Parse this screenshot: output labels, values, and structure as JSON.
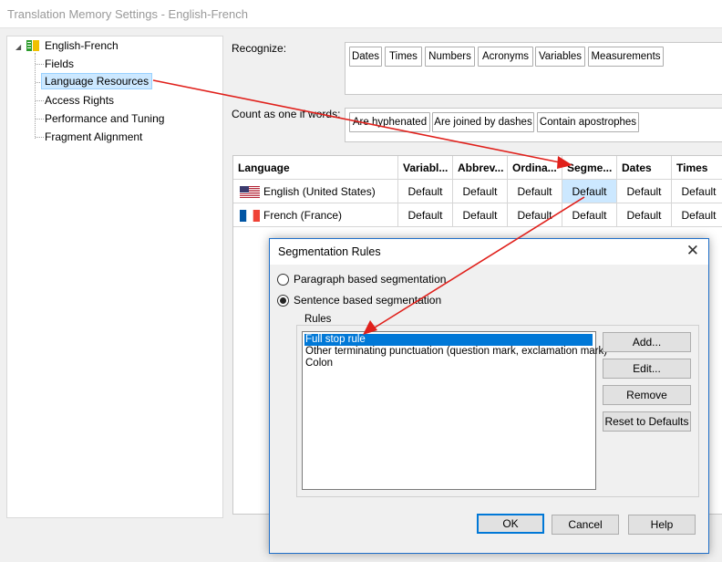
{
  "window": {
    "title": "Translation Memory Settings - English-French"
  },
  "tree": {
    "root": "English-French",
    "items": [
      "Fields",
      "Language Resources",
      "Access Rights",
      "Performance and Tuning",
      "Fragment Alignment"
    ],
    "selected": "Language Resources"
  },
  "recognize": {
    "label": "Recognize:",
    "tokens": [
      "Dates",
      "Times",
      "Numbers",
      "Acronyms",
      "Variables",
      "Measurements"
    ]
  },
  "count_as_one": {
    "label": "Count as one if words:",
    "tokens": [
      "Are hyphenated",
      "Are joined by dashes",
      "Contain apostrophes"
    ]
  },
  "grid": {
    "headers": [
      "Language",
      "Variabl...",
      "Abbrev...",
      "Ordina...",
      "Segme...",
      "Dates",
      "Times"
    ],
    "rows": [
      {
        "language": "English (United States)",
        "flag": "us-flag",
        "values": [
          "Default",
          "Default",
          "Default",
          "Default",
          "Default",
          "Default"
        ]
      },
      {
        "language": "French (France)",
        "flag": "fr-flag",
        "values": [
          "Default",
          "Default",
          "Default",
          "Default",
          "Default",
          "Default"
        ]
      }
    ],
    "selected_column": "Segme..."
  },
  "dialog": {
    "title": "Segmentation Rules",
    "options": [
      "Paragraph based segmentation",
      "Sentence based segmentation"
    ],
    "selected_option": "Sentence based segmentation",
    "rules_label": "Rules",
    "rules": [
      "Full stop rule",
      "Other terminating punctuation (question mark, exclamation mark)",
      "Colon"
    ],
    "selected_rule": "Full stop rule",
    "side_buttons": [
      "Add...",
      "Edit...",
      "Remove",
      "Reset to Defaults"
    ],
    "footer_buttons": [
      "OK",
      "Cancel",
      "Help"
    ]
  },
  "colors": {
    "accent": "#0078d7",
    "annotation_arrow": "#e0201b",
    "selection": "#cce8ff"
  }
}
